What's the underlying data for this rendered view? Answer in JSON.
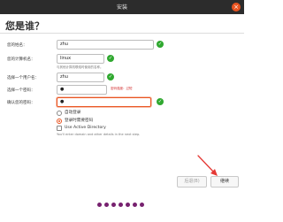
{
  "window": {
    "title": "安装",
    "close_glyph": "×"
  },
  "heading": "您是谁？",
  "form": {
    "name": {
      "label": "您的姓名：",
      "value": "zhu",
      "check": "✓"
    },
    "computer": {
      "label": "您的计算机名：",
      "value": "linux",
      "hint": "与其他计算机联络时使用的名称。",
      "check": "✓"
    },
    "username": {
      "label": "选择一个用户名：",
      "value": "zhu",
      "check": "✓"
    },
    "password": {
      "label": "选择一个密码：",
      "value": "●",
      "strength": "密码强度：过短"
    },
    "confirm": {
      "label": "确认您的密码：",
      "value": "●",
      "check": "✓"
    }
  },
  "login_options": {
    "auto_login": "自动登录",
    "require_password": "登录时需要密码",
    "active_directory": "Use Active Directory",
    "ad_hint": "You'll enter domain and other details in the next step."
  },
  "buttons": {
    "back": "后退(B)",
    "continue": "继续"
  },
  "progress": {
    "total_steps": 7,
    "current_step": 7
  },
  "colors": {
    "accent": "#e95420",
    "success": "#2fa82f",
    "progress": "#77216f"
  }
}
